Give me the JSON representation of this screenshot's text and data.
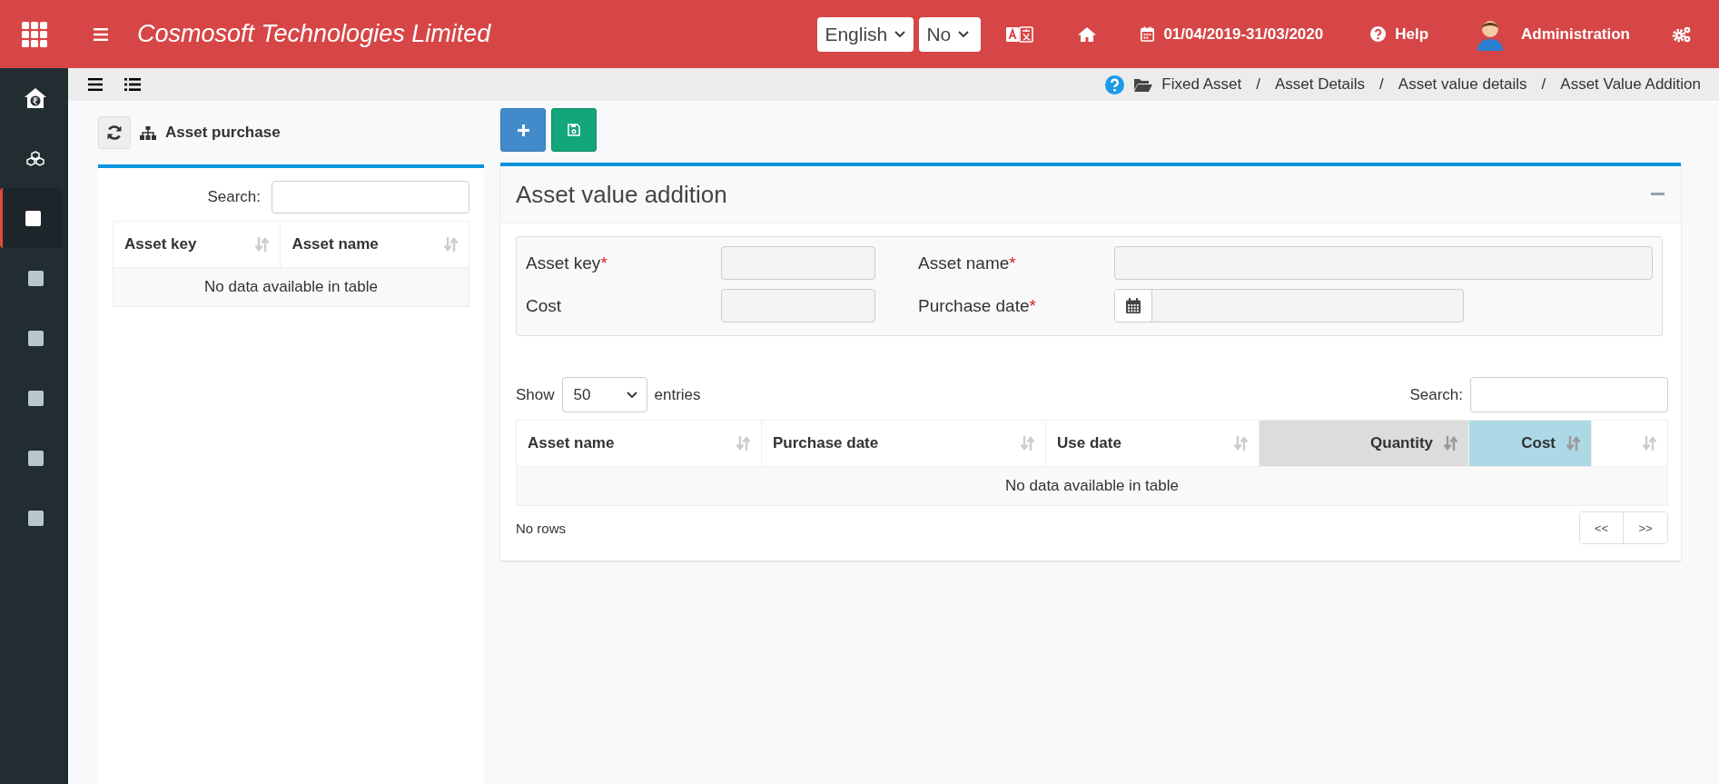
{
  "topbar": {
    "company": "Cosmosoft Technologies Limited",
    "language": "English",
    "option": "No",
    "financial_year": "01/04/2019-31/03/2020",
    "help": "Help",
    "user": "Administration"
  },
  "sidebar": {
    "items": [
      {
        "kind": "home",
        "selected": false
      },
      {
        "kind": "cubes",
        "selected": false
      },
      {
        "kind": "square",
        "selected": true
      },
      {
        "kind": "square",
        "selected": false
      },
      {
        "kind": "square",
        "selected": false
      },
      {
        "kind": "square",
        "selected": false
      },
      {
        "kind": "square",
        "selected": false
      },
      {
        "kind": "square",
        "selected": false
      }
    ]
  },
  "breadcrumb": [
    "Fixed Asset",
    "Asset Details",
    "Asset value details",
    "Asset Value Addition"
  ],
  "breadcrumb_separator": "/",
  "left_panel": {
    "title": "Asset purchase",
    "search_label": "Search:",
    "columns": [
      "Asset key",
      "Asset name"
    ],
    "empty_message": "No data available in table"
  },
  "right_panel": {
    "title": "Asset value addition",
    "required_mark": "*",
    "fields": [
      {
        "label": "Asset key",
        "required": true,
        "kind": "text"
      },
      {
        "label": "Asset name",
        "required": true,
        "kind": "text"
      },
      {
        "label": "Cost",
        "required": false,
        "kind": "text"
      },
      {
        "label": "Purchase date",
        "required": true,
        "kind": "date"
      }
    ],
    "table": {
      "show_label": "Show",
      "page_size": "50",
      "entries_label": "entries",
      "search_label": "Search:",
      "columns": [
        {
          "label": "Asset name",
          "numeric": false
        },
        {
          "label": "Purchase date",
          "numeric": false
        },
        {
          "label": "Use date",
          "numeric": false
        },
        {
          "label": "Quantity",
          "numeric": true,
          "color": "#dcdcdc"
        },
        {
          "label": "Cost",
          "numeric": true,
          "color": "#add8e6"
        }
      ],
      "trailing_column": true,
      "empty_message": "No data available in table",
      "footer": "No rows",
      "pagination": [
        "<<",
        ">>"
      ]
    }
  }
}
